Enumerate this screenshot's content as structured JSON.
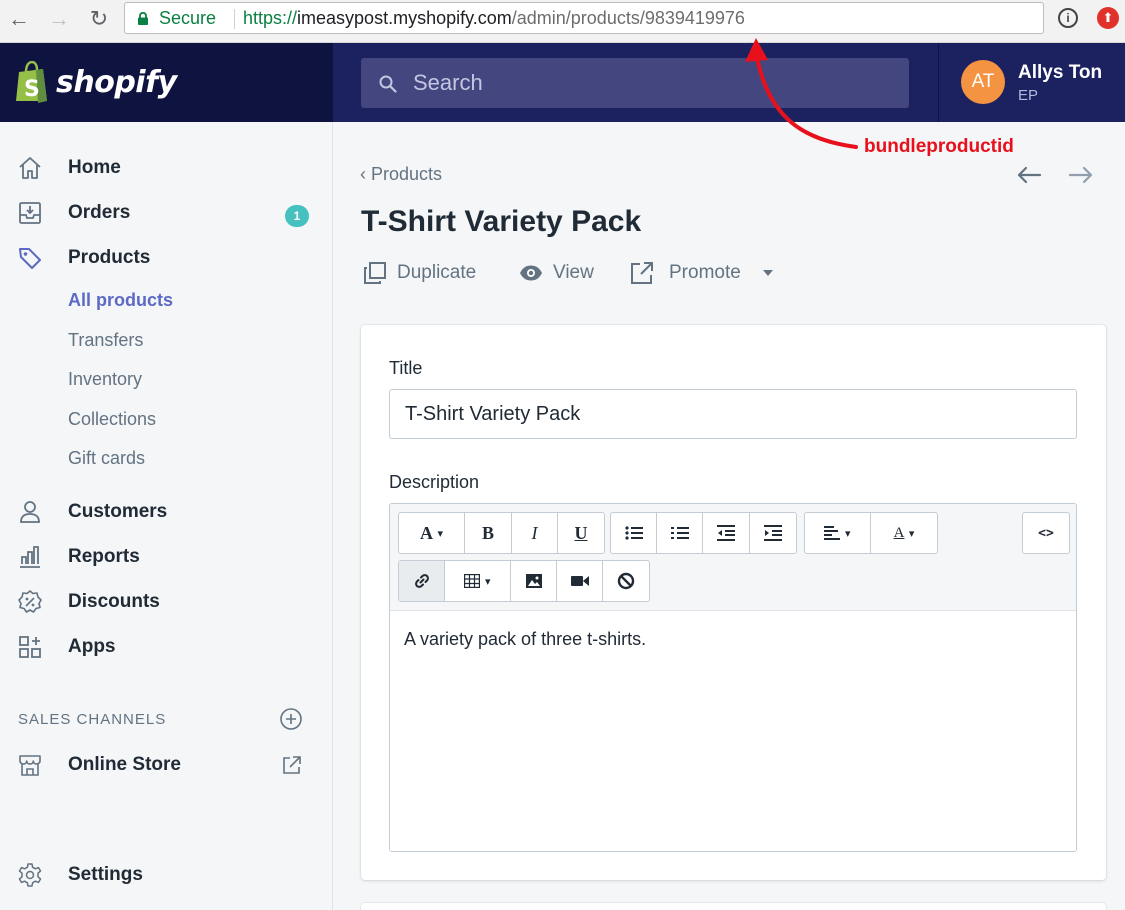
{
  "browser": {
    "back_glyph": "←",
    "forward_glyph": "→",
    "reload_glyph": "↻",
    "secure_label": "Secure",
    "url_scheme": "https://",
    "url_host": "imeasypost.myshopify.com",
    "url_path": "/admin/products/9839419976",
    "star_glyph": "☆",
    "ext_info_glyph": "i",
    "ext_red_glyph": "⬆"
  },
  "topbar": {
    "logo_text": "shopify",
    "logo_letter": "S",
    "search_placeholder": "Search",
    "avatar_initials": "AT",
    "user_name": "Allys Ton",
    "shop_name": "EP",
    "colors": {
      "topbar": "#1c2260",
      "logo_area": "#0f1340",
      "search": "#43467f",
      "avatar": "#f49342"
    }
  },
  "sidebar": {
    "home": "Home",
    "orders": "Orders",
    "orders_badge": "1",
    "products": "Products",
    "products_sub": [
      "All products",
      "Transfers",
      "Inventory",
      "Collections",
      "Gift cards"
    ],
    "customers": "Customers",
    "reports": "Reports",
    "discounts": "Discounts",
    "apps": "Apps",
    "sales_channels_heading": "SALES CHANNELS",
    "online_store": "Online Store",
    "settings": "Settings",
    "active_color": "#5c6ac4",
    "badge_color": "#47c1bf"
  },
  "main": {
    "breadcrumb": "Products",
    "breadcrumb_glyph": "‹",
    "title": "T-Shirt Variety Pack",
    "actions": {
      "duplicate": "Duplicate",
      "view": "View",
      "promote": "Promote"
    }
  },
  "card": {
    "title_label": "Title",
    "title_value": "T-Shirt Variety Pack",
    "description_label": "Description",
    "description_text": "A variety pack of three t-shirts.",
    "toolbar": {
      "font": "A",
      "bold": "B",
      "italic": "I",
      "underline": "U",
      "align": "≡",
      "color": "A",
      "code": "<>",
      "caret": "▾"
    }
  },
  "annotation": {
    "label": "bundleproductid",
    "color": "#e8111b"
  }
}
